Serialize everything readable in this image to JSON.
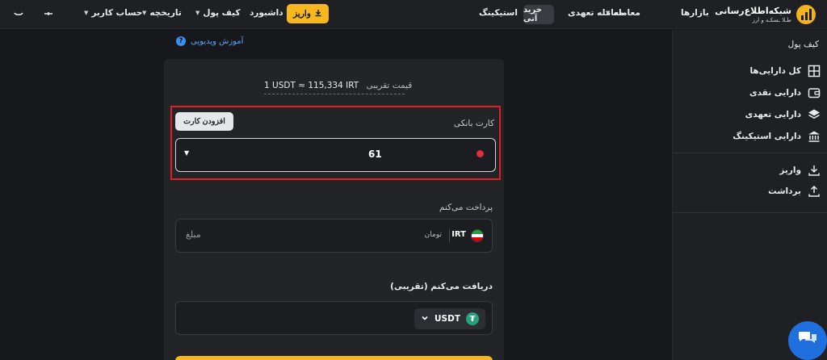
{
  "topbar": {
    "logo_title": "شبکه‌اطلاع‌رسانی",
    "logo_sub": "طـلا ـسکـه و ارز",
    "nav": {
      "markets": "بازارها",
      "trade": "معامله",
      "futures": "معامله تعهدی",
      "spot": "خرید آنی",
      "staking": "استیکینگ",
      "deposit": "واریز",
      "dashboard": "داشبورد",
      "wallet": "کیف پول",
      "history": "تاریخچه",
      "account": "حساب کاربر"
    }
  },
  "sidebar": {
    "title": "کیف پول",
    "items": [
      {
        "label": "کل دارایی‌ها",
        "icon": "grid-icon"
      },
      {
        "label": "دارایی نقدی",
        "icon": "wallet-icon"
      },
      {
        "label": "دارایی تعهدی",
        "icon": "layers-icon"
      },
      {
        "label": "دارایی استیکینگ",
        "icon": "bank-icon"
      }
    ],
    "actions": [
      {
        "label": "واریز",
        "icon": "download-icon"
      },
      {
        "label": "برداشت",
        "icon": "upload-icon"
      }
    ]
  },
  "main": {
    "video_link": "آموزش ویدیویی",
    "rate_label": "قیمت تقریبی",
    "rate_value": "1 USDT ≈ 115,334 IRT",
    "bank_card_label": "کارت بانکی",
    "add_card": "افزودن کارت",
    "selected_card": "61",
    "pay_label": "پرداخت می‌کنم",
    "pay_currency": "IRT",
    "pay_unit": "تومان",
    "pay_placeholder": "مبلغ",
    "receive_label": "دریافت می‌کنم (تقریبی)",
    "receive_asset": "USDT"
  },
  "colors": {
    "accent": "#f7b81e",
    "highlight": "#e01e24",
    "link": "#58a6f5",
    "chat": "#1f6fde"
  }
}
